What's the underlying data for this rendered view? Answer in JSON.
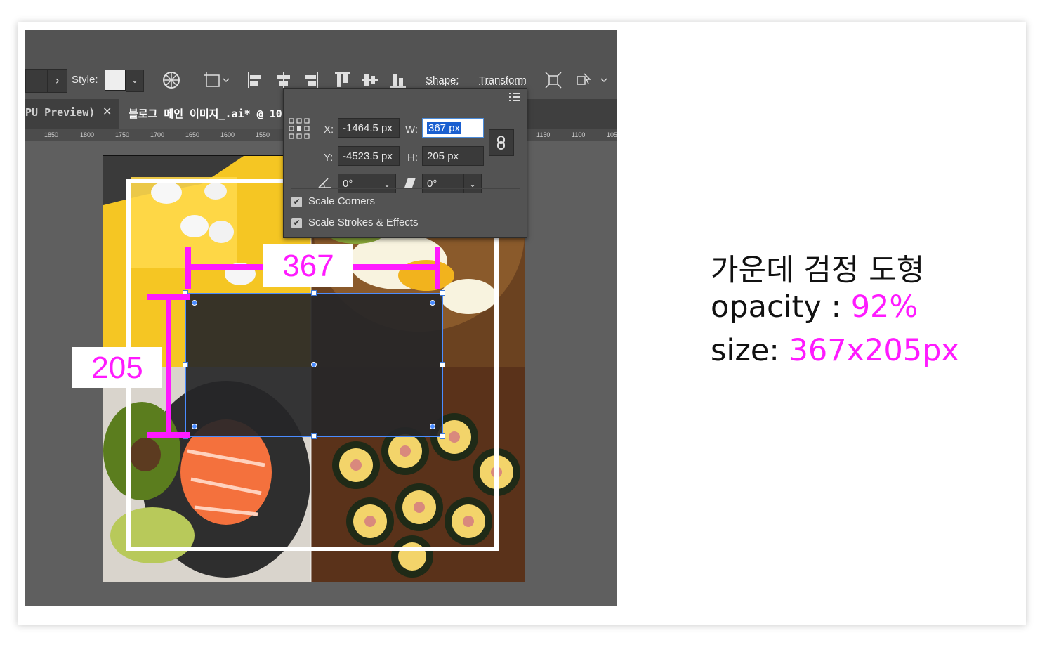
{
  "toolbar": {
    "style_label": "Style:",
    "shape_label": "Shape:",
    "transform_label": "Transform"
  },
  "tabs": [
    {
      "label": "PU Preview)"
    },
    {
      "label": "블로그 메인 이미지_.ai* @ 10"
    }
  ],
  "ruler": {
    "ticks": [
      "1850",
      "1800",
      "1750",
      "1700",
      "1650",
      "1600",
      "1550",
      "1150",
      "1100",
      "105"
    ]
  },
  "transform_panel": {
    "x_label": "X:",
    "x_value": "-1464.5 px",
    "y_label": "Y:",
    "y_value": "-4523.5 px",
    "w_label": "W:",
    "w_value": "367 px",
    "h_label": "H:",
    "h_value": "205 px",
    "rotate_value": "0°",
    "shear_value": "0°",
    "scale_corners_label": "Scale Corners",
    "scale_corners_checked": true,
    "scale_strokes_label": "Scale Strokes & Effects",
    "scale_strokes_checked": true
  },
  "annotations": {
    "width_label": "367",
    "height_label": "205"
  },
  "description": {
    "line1": "가운데 검정 도형",
    "opacity_prefix": "opacity : ",
    "opacity_value": "92%",
    "size_prefix": "size: ",
    "size_value": "367x205px"
  },
  "colors": {
    "accent": "#ff1aff",
    "app_bg": "#5f5f5f",
    "panel_bg": "#535353",
    "selection": "#4a8cff"
  },
  "shape": {
    "opacity_percent": 92
  }
}
